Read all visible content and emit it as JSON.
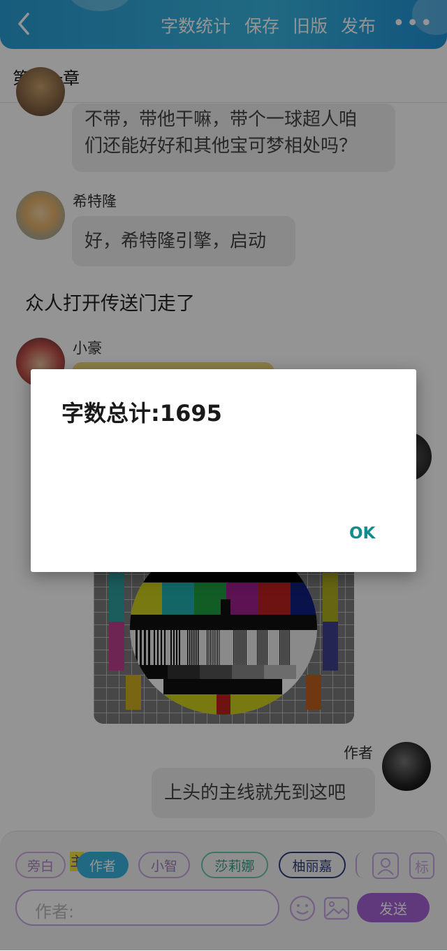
{
  "header": {
    "actions": [
      "字数统计",
      "保存",
      "旧版",
      "发布"
    ],
    "more": "•••"
  },
  "chapter_title": "第十一章",
  "messages": [
    {
      "speaker": "",
      "text_lines": [
        "不带，带他干嘛，带个一球超人咱",
        "们还能好好和其他宝可梦相处吗？"
      ]
    },
    {
      "speaker": "希特隆",
      "text": "好，希特隆引擎，启动"
    },
    {
      "narration": "众人打开传送门走了"
    },
    {
      "speaker": "小豪",
      "text": ""
    },
    {
      "speaker": "作者",
      "text": "上头的主线就先到这吧"
    }
  ],
  "role_bar": {
    "main_marker": "主",
    "roles": [
      "旁白",
      "作者",
      "小智",
      "莎莉娜",
      "柚丽嘉"
    ],
    "selected": "作者"
  },
  "input": {
    "placeholder": "作者:"
  },
  "send_label": "发送",
  "tag_button": "标",
  "dialog": {
    "message": "字数总计:1695",
    "ok_label": "OK"
  },
  "colors": {
    "header_blue": "#2a9ed6",
    "accent_purple": "#a463d6",
    "dialog_ok": "#128c8c",
    "selected_role": "#39b6e0"
  }
}
